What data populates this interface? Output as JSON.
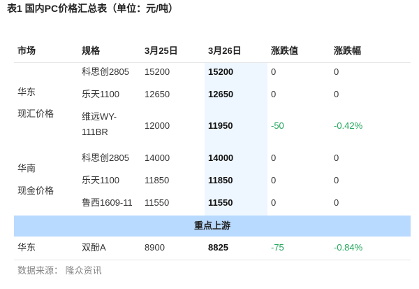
{
  "title": "表1  国内PC价格汇总表（单位：元/吨）",
  "columns": [
    "市场",
    "规格",
    "3月25日",
    "3月26日",
    "涨跌值",
    "涨跌幅"
  ],
  "groups": [
    {
      "market": [
        "华东",
        "现汇价格"
      ],
      "rows": [
        {
          "spec": "科思创2805",
          "mar25": "15200",
          "mar26": "15200",
          "change": "0",
          "pct": "0"
        },
        {
          "spec": "乐天1100",
          "mar25": "12650",
          "mar26": "12650",
          "change": "0",
          "pct": "0"
        },
        {
          "spec": "维远WY-111BR",
          "mar25": "12000",
          "mar26": "11950",
          "change": "-50",
          "pct": "-0.42%"
        }
      ]
    },
    {
      "market": [
        "华南",
        "现金价格"
      ],
      "rows": [
        {
          "spec": "科思创2805",
          "mar25": "14000",
          "mar26": "14000",
          "change": "0",
          "pct": "0"
        },
        {
          "spec": "乐天1100",
          "mar25": "11850",
          "mar26": "11850",
          "change": "0",
          "pct": "0"
        },
        {
          "spec": "鲁西1609-11",
          "mar25": "11550",
          "mar26": "11550",
          "change": "0",
          "pct": "0"
        }
      ]
    }
  ],
  "upstream_label": "重点上游",
  "upstream_row": {
    "market": "华东",
    "spec": "双酚A",
    "mar25": "8900",
    "mar26": "8825",
    "change": "-75",
    "pct": "-0.84%"
  },
  "source": "数据来源：  隆众资讯",
  "colors": {
    "highlight_col": "#eef7ff",
    "band": "#b9daff",
    "negative": "#22a65a"
  }
}
